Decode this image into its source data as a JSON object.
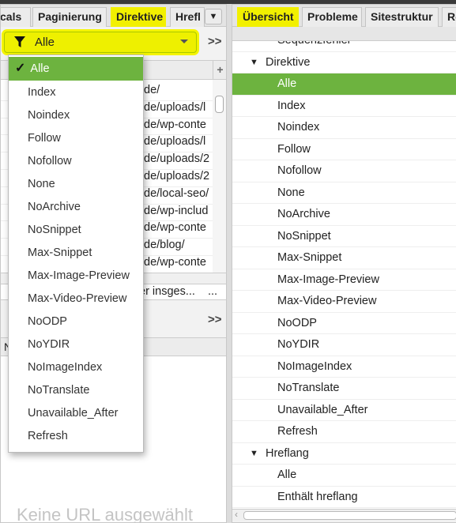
{
  "left": {
    "tabs": [
      {
        "label": "cals"
      },
      {
        "label": "Paginierung"
      },
      {
        "label": "Direktive",
        "highlighted": true
      },
      {
        "label": "Hrefl"
      }
    ],
    "tab_menu_icon": "triangle-down",
    "filter": {
      "icon": "funnel",
      "value": "Alle"
    },
    "expand_label": ">>",
    "add_column_label": "+",
    "rows": [
      "de/",
      "de/uploads/l",
      "de/wp-conte",
      "de/uploads/l",
      "de/uploads/2",
      "de/uploads/2",
      "de/local-seo/",
      "de/wp-includ",
      "de/wp-conte",
      "de/blog/",
      "de/wp-conte"
    ],
    "status_text": "er insges...",
    "status_more": "...",
    "lower_expand_label": ">>",
    "lower_header": "N",
    "empty_text": "Keine URL ausgewählt"
  },
  "dropdown": {
    "checkmark": "✓",
    "items": [
      "Alle",
      "Index",
      "Noindex",
      "Follow",
      "Nofollow",
      "None",
      "NoArchive",
      "NoSnippet",
      "Max-Snippet",
      "Max-Image-Preview",
      "Max-Video-Preview",
      "NoODP",
      "NoYDIR",
      "NoImageIndex",
      "NoTranslate",
      "Unavailable_After",
      "Refresh"
    ],
    "selected": "Alle"
  },
  "right": {
    "tabs": [
      {
        "label": "Übersicht",
        "highlighted": true
      },
      {
        "label": "Probleme"
      },
      {
        "label": "Sitestruktur"
      },
      {
        "label": "Re"
      }
    ],
    "tree": [
      {
        "label": "Sequenzfehler",
        "level": 2
      },
      {
        "label": "Direktive",
        "level": 1,
        "expanded": true
      },
      {
        "label": "Alle",
        "level": 2,
        "selected": true
      },
      {
        "label": "Index",
        "level": 2
      },
      {
        "label": "Noindex",
        "level": 2
      },
      {
        "label": "Follow",
        "level": 2
      },
      {
        "label": "Nofollow",
        "level": 2
      },
      {
        "label": "None",
        "level": 2
      },
      {
        "label": "NoArchive",
        "level": 2
      },
      {
        "label": "NoSnippet",
        "level": 2
      },
      {
        "label": "Max-Snippet",
        "level": 2
      },
      {
        "label": "Max-Image-Preview",
        "level": 2
      },
      {
        "label": "Max-Video-Preview",
        "level": 2
      },
      {
        "label": "NoODP",
        "level": 2
      },
      {
        "label": "NoYDIR",
        "level": 2
      },
      {
        "label": "NoImageIndex",
        "level": 2
      },
      {
        "label": "NoTranslate",
        "level": 2
      },
      {
        "label": "Unavailable_After",
        "level": 2
      },
      {
        "label": "Refresh",
        "level": 2
      },
      {
        "label": "Hreflang",
        "level": 1,
        "expanded": true
      },
      {
        "label": "Alle",
        "level": 2
      },
      {
        "label": "Enthält hreflang",
        "level": 2
      }
    ]
  },
  "colors": {
    "highlight": "#f2f000",
    "selected": "#6db33f"
  }
}
